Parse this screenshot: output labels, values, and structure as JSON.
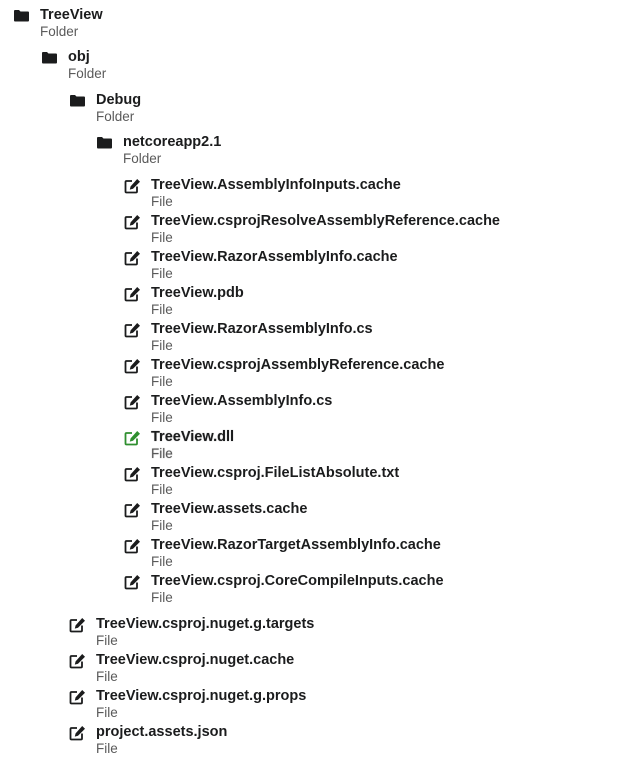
{
  "tree": {
    "root": {
      "title": "TreeView",
      "desc": "Folder",
      "icon": "folder-icon"
    },
    "obj": {
      "title": "obj",
      "desc": "Folder",
      "icon": "folder-icon"
    },
    "debug": {
      "title": "Debug",
      "desc": "Folder",
      "icon": "folder-icon"
    },
    "netcore": {
      "title": "netcoreapp2.1",
      "desc": "Folder",
      "icon": "folder-icon"
    },
    "netcore_files": [
      {
        "title": "TreeView.AssemblyInfoInputs.cache",
        "desc": "File",
        "icon": "edit-icon"
      },
      {
        "title": "TreeView.csprojResolveAssemblyReference.cache",
        "desc": "File",
        "icon": "edit-icon"
      },
      {
        "title": "TreeView.RazorAssemblyInfo.cache",
        "desc": "File",
        "icon": "edit-icon"
      },
      {
        "title": "TreeView.pdb",
        "desc": "File",
        "icon": "edit-icon"
      },
      {
        "title": "TreeView.RazorAssemblyInfo.cs",
        "desc": "File",
        "icon": "edit-icon"
      },
      {
        "title": "TreeView.csprojAssemblyReference.cache",
        "desc": "File",
        "icon": "edit-icon"
      },
      {
        "title": "TreeView.AssemblyInfo.cs",
        "desc": "File",
        "icon": "edit-icon"
      },
      {
        "title": "TreeView.dll",
        "desc": "File",
        "icon": "edit-icon",
        "selected": true
      },
      {
        "title": "TreeView.csproj.FileListAbsolute.txt",
        "desc": "File",
        "icon": "edit-icon"
      },
      {
        "title": "TreeView.assets.cache",
        "desc": "File",
        "icon": "edit-icon"
      },
      {
        "title": "TreeView.RazorTargetAssemblyInfo.cache",
        "desc": "File",
        "icon": "edit-icon"
      },
      {
        "title": "TreeView.csproj.CoreCompileInputs.cache",
        "desc": "File",
        "icon": "edit-icon"
      }
    ],
    "obj_files": [
      {
        "title": "TreeView.csproj.nuget.g.targets",
        "desc": "File",
        "icon": "edit-icon"
      },
      {
        "title": "TreeView.csproj.nuget.cache",
        "desc": "File",
        "icon": "edit-icon"
      },
      {
        "title": "TreeView.csproj.nuget.g.props",
        "desc": "File",
        "icon": "edit-icon"
      },
      {
        "title": "project.assets.json",
        "desc": "File",
        "icon": "edit-icon"
      }
    ]
  }
}
